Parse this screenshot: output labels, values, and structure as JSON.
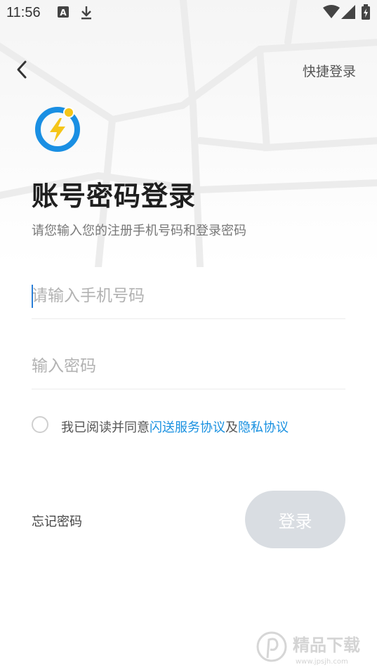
{
  "status_bar": {
    "time": "11:56",
    "icons": [
      "text-a-icon",
      "download-icon",
      "wifi-icon",
      "signal-icon",
      "battery-charging-icon"
    ]
  },
  "nav": {
    "back_icon": "chevron-left-icon",
    "quick_login_label": "快捷登录"
  },
  "logo": {
    "icon": "lightning-bolt-logo",
    "accent_color": "#1a8fe3",
    "bolt_color": "#f5c518"
  },
  "title": "账号密码登录",
  "subtitle": "请您输入您的注册手机号码和登录密码",
  "phone_field": {
    "placeholder": "请输入手机号码",
    "value": ""
  },
  "password_field": {
    "placeholder": "输入密码",
    "value": ""
  },
  "agreement": {
    "checked": false,
    "prefix": "我已阅读并同意",
    "service_link": "闪送服务协议",
    "and": "及",
    "privacy_link": "隐私协议"
  },
  "forgot_password_label": "忘记密码",
  "login_button_label": "登录",
  "colors": {
    "link": "#1890e0",
    "button_disabled_bg": "#d9dde2",
    "caret": "#2a7fd8"
  },
  "watermark": {
    "cn": "精品下载",
    "url": "www.jpsjh.com"
  }
}
